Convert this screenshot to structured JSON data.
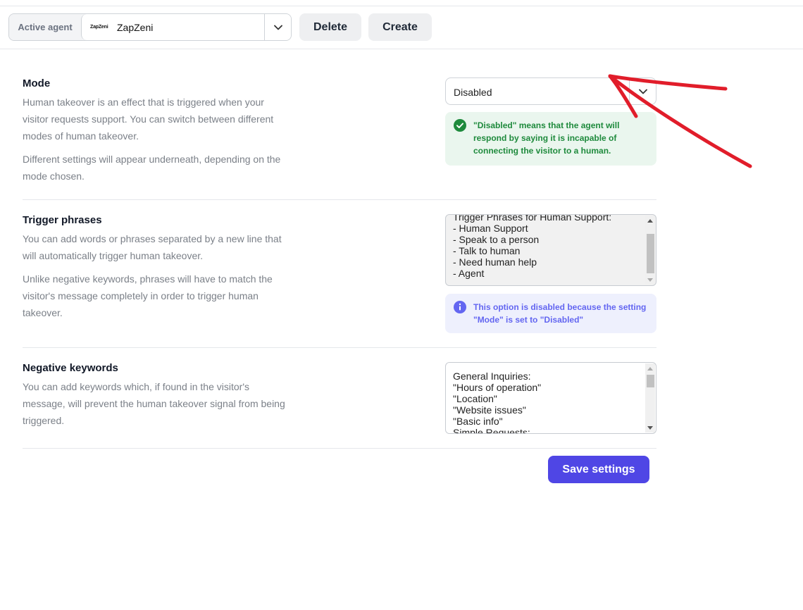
{
  "toolbar": {
    "active_agent_label": "Active agent",
    "agent_logo_text": "ZapZeni",
    "agent_name": "ZapZeni",
    "delete_label": "Delete",
    "create_label": "Create"
  },
  "mode": {
    "title": "Mode",
    "desc_1": "Human takeover is an effect that is triggered when your visitor requests support. You can switch between different modes of human takeover.",
    "desc_2": "Different settings will appear underneath, depending on the mode chosen.",
    "selected_value": "Disabled",
    "alert_text": "\"Disabled\" means that the agent will respond by saying it is incapable of connecting the visitor to a human."
  },
  "trigger": {
    "title": "Trigger phrases",
    "desc_1": "You can add words or phrases separated by a new line that will automatically trigger human takeover.",
    "desc_2": "Unlike negative keywords, phrases will have to match the visitor's message completely in order to trigger human takeover.",
    "textarea_content": "Trigger Phrases for Human Support:\n- Human Support\n- Speak to a person\n- Talk to human\n- Need human help\n- Agent",
    "alert_text": "This option is disabled because the setting \"Mode\" is set to \"Disabled\""
  },
  "negative": {
    "title": "Negative keywords",
    "desc_1": "You can add keywords which, if found in the visitor's message, will prevent the human takeover signal from being triggered.",
    "textarea_content": "General Inquiries:\n\"Hours of operation\"\n\"Location\"\n\"Website issues\"\n\"Basic info\"\nSimple Requests:"
  },
  "save_label": "Save settings",
  "colors": {
    "accent": "#4f46e5",
    "success_bg": "#eaf6ee",
    "success_text": "#1e8a3c",
    "info_bg": "#eef0fd",
    "info_text": "#6366f1",
    "annotation": "#e11d2a"
  }
}
